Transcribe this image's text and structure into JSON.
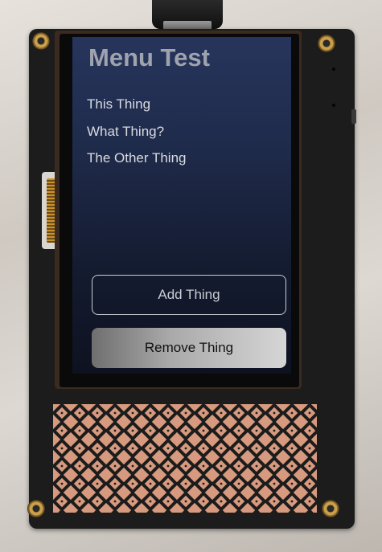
{
  "screen": {
    "title": "Menu Test",
    "menu_items": [
      {
        "label": "This Thing"
      },
      {
        "label": "What Thing?"
      },
      {
        "label": "The Other Thing"
      }
    ],
    "buttons": {
      "add_label": "Add Thing",
      "remove_label": "Remove Thing"
    }
  },
  "colors": {
    "screen_top": "#27355d",
    "screen_bottom": "#0e1220",
    "title_text": "#9fa3ad",
    "menu_text": "#d9dbe0",
    "pcb": "#1c1c1c",
    "copper": "#d79a7f"
  },
  "hardware": {
    "connector": "usb-c",
    "mount_holes": 4
  }
}
